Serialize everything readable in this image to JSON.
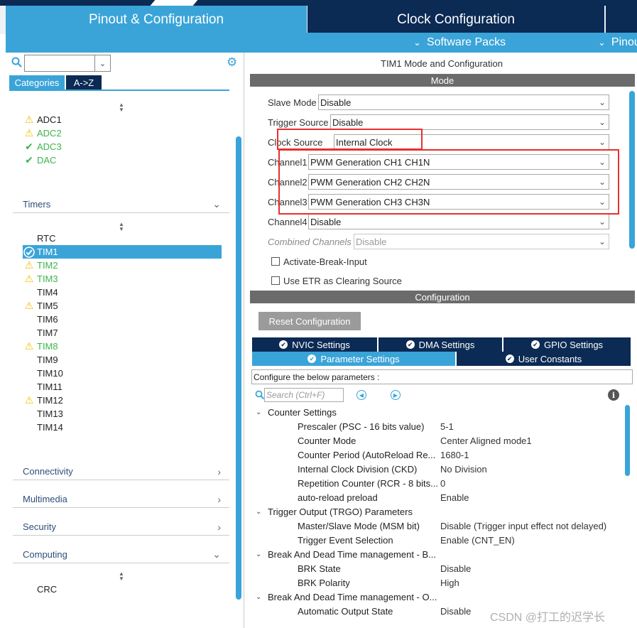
{
  "header": {
    "tabs": [
      {
        "label": "Pinout & Configuration",
        "active": true
      },
      {
        "label": "Clock Configuration",
        "active": false
      }
    ],
    "subtabs": [
      {
        "label": "Software Packs"
      },
      {
        "label": "Pinout"
      }
    ]
  },
  "sidebar": {
    "search_value": "",
    "view_tabs": [
      "Categories",
      "A->Z"
    ],
    "analog_items": [
      {
        "label": "ADC1",
        "status": "warning",
        "color": "default"
      },
      {
        "label": "ADC2",
        "status": "warning",
        "color": "green"
      },
      {
        "label": "ADC3",
        "status": "ok",
        "color": "green"
      },
      {
        "label": "DAC",
        "status": "ok",
        "color": "green"
      }
    ],
    "sections": {
      "timers": "Timers",
      "connectivity": "Connectivity",
      "multimedia": "Multimedia",
      "security": "Security",
      "computing": "Computing"
    },
    "timer_items": [
      {
        "label": "RTC",
        "status": "none",
        "color": "default"
      },
      {
        "label": "TIM1",
        "status": "ok",
        "color": "default",
        "selected": true
      },
      {
        "label": "TIM2",
        "status": "warning",
        "color": "green"
      },
      {
        "label": "TIM3",
        "status": "warning",
        "color": "green"
      },
      {
        "label": "TIM4",
        "status": "none",
        "color": "default"
      },
      {
        "label": "TIM5",
        "status": "warning",
        "color": "default"
      },
      {
        "label": "TIM6",
        "status": "none",
        "color": "default"
      },
      {
        "label": "TIM7",
        "status": "none",
        "color": "default"
      },
      {
        "label": "TIM8",
        "status": "warning",
        "color": "green"
      },
      {
        "label": "TIM9",
        "status": "none",
        "color": "default"
      },
      {
        "label": "TIM10",
        "status": "none",
        "color": "default"
      },
      {
        "label": "TIM11",
        "status": "none",
        "color": "default"
      },
      {
        "label": "TIM12",
        "status": "warning",
        "color": "default"
      },
      {
        "label": "TIM13",
        "status": "none",
        "color": "default"
      },
      {
        "label": "TIM14",
        "status": "none",
        "color": "default"
      }
    ],
    "computing_items": [
      {
        "label": "CRC"
      }
    ]
  },
  "mode": {
    "title": "TIM1 Mode and Configuration",
    "header": "Mode",
    "fields": {
      "slave_mode": {
        "label": "Slave Mode",
        "value": "Disable"
      },
      "trigger_source": {
        "label": "Trigger Source",
        "value": "Disable"
      },
      "clock_source": {
        "label": "Clock Source",
        "value": "Internal Clock"
      },
      "channel1": {
        "label": "Channel1",
        "value": "PWM Generation CH1 CH1N"
      },
      "channel2": {
        "label": "Channel2",
        "value": "PWM Generation CH2 CH2N"
      },
      "channel3": {
        "label": "Channel3",
        "value": "PWM Generation CH3 CH3N"
      },
      "channel4": {
        "label": "Channel4",
        "value": "Disable"
      },
      "combined": {
        "label": "Combined Channels",
        "value": "Disable"
      }
    },
    "checkboxes": {
      "break_input": "Activate-Break-Input",
      "etr_clearing": "Use ETR as Clearing Source"
    }
  },
  "configuration": {
    "header": "Configuration",
    "reset_label": "Reset Configuration",
    "settings_tabs": {
      "nvic": "NVIC Settings",
      "dma": "DMA Settings",
      "gpio": "GPIO Settings",
      "parameter": "Parameter Settings",
      "user_constants": "User Constants"
    },
    "hint": "Configure the below parameters :",
    "search_placeholder": "Search (Ctrl+F)",
    "groups": {
      "counter": "Counter Settings",
      "trgo": "Trigger Output (TRGO) Parameters",
      "break_b": "Break And Dead Time management - B...",
      "break_o": "Break And Dead Time management - O..."
    },
    "params": {
      "prescaler": {
        "name": "Prescaler (PSC - 16 bits value)",
        "value": "5-1"
      },
      "counter_mode": {
        "name": "Counter Mode",
        "value": "Center Aligned mode1"
      },
      "counter_period": {
        "name": "Counter Period (AutoReload Re...",
        "value": "1680-1"
      },
      "ckd": {
        "name": "Internal Clock Division (CKD)",
        "value": "No Division"
      },
      "rcr": {
        "name": "Repetition Counter (RCR - 8 bits...",
        "value": "0"
      },
      "arpe": {
        "name": "auto-reload preload",
        "value": "Enable"
      },
      "msm": {
        "name": "Master/Slave Mode (MSM bit)",
        "value": "Disable (Trigger input effect not delayed)"
      },
      "trgo_event": {
        "name": "Trigger Event Selection",
        "value": "Enable (CNT_EN)"
      },
      "brk_state": {
        "name": "BRK State",
        "value": "Disable"
      },
      "brk_polarity": {
        "name": "BRK Polarity",
        "value": "High"
      },
      "auto_output": {
        "name": "Automatic Output State",
        "value": "Disable"
      }
    }
  },
  "watermark": "CSDN @打工的迟学长",
  "colors": {
    "accent": "#3aa4d8",
    "navy": "#0b2a54",
    "warning": "#f2c200",
    "ok": "#3bb54a",
    "highlight_box": "#e8302c"
  }
}
